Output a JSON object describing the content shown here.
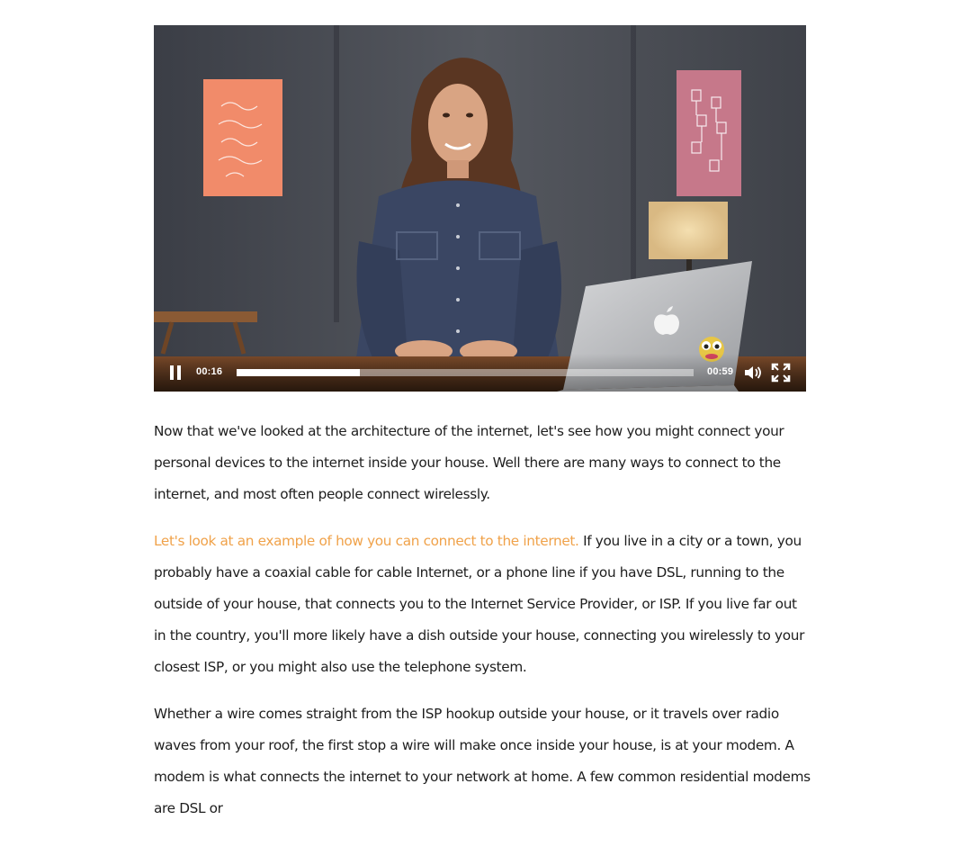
{
  "video": {
    "current_time": "00:16",
    "duration": "00:59",
    "progress": 0.27,
    "state": "playing",
    "controls": {
      "pause_icon": "pause-icon",
      "volume_icon": "volume-icon",
      "fullscreen_icon": "fullscreen-icon"
    }
  },
  "article": {
    "p1": "Now that we've looked at the architecture of the internet, let's see how you might connect your personal devices to the internet inside your house. Well there are many ways to connect to the internet, and most often people connect wirelessly.",
    "p2_highlight": "Let's look at an example of how you can connect to the internet.",
    "p2_rest": " If you live in a city or a town, you probably have a coaxial cable for cable Internet, or a phone line if you have DSL, running to the outside of your house, that connects you to the Internet Service Provider, or ISP. If you live far out in the country, you'll more likely have a dish outside your house, connecting you wirelessly to your closest ISP, or you might also use the telephone system.",
    "p3": "Whether a wire comes straight from the ISP hookup outside your house, or it travels over radio waves from your roof, the first stop a wire will make once inside your house, is at your modem. A modem is what connects the internet to your network at home. A few common residential modems are DSL or"
  },
  "colors": {
    "highlight": "#f0a24a",
    "text": "#1e1e1e",
    "video_wall": "#4a4d55"
  }
}
